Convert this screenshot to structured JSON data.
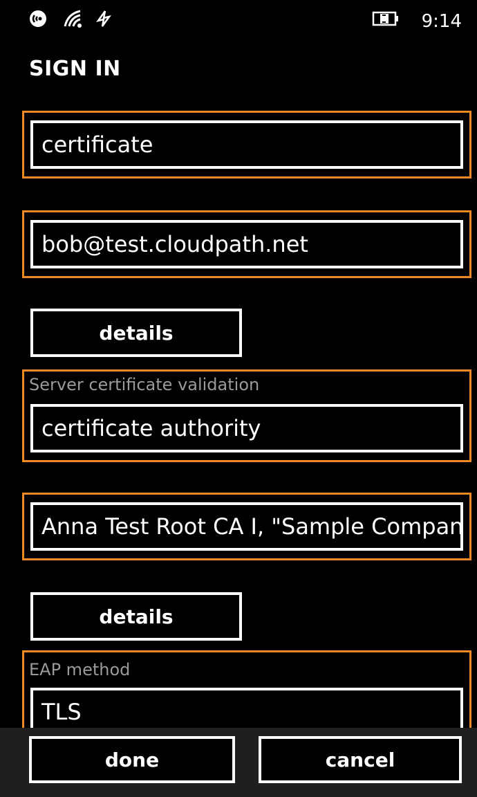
{
  "status_bar": {
    "icons": [
      "nfc-icon",
      "wifi-icon",
      "data-sync-icon",
      "battery-charging-icon"
    ],
    "time": "9:14"
  },
  "page": {
    "title": "SIGN IN"
  },
  "form": {
    "username_value": "certificate",
    "identity_value": "bob@test.cloudpath.net",
    "details_label_1": "details",
    "server_validation_label": "Server certificate validation",
    "server_validation_value": "certificate authority",
    "ca_value": "Anna Test Root CA I, \"Sample Company\"",
    "details_label_2": "details",
    "eap_method_label": "EAP method",
    "eap_method_value": "TLS"
  },
  "app_bar": {
    "done_label": "done",
    "cancel_label": "cancel"
  },
  "colors": {
    "highlight": "#f08a24",
    "background": "#000000",
    "foreground": "#ffffff",
    "label": "#9a9a9a",
    "app_bar": "#1f1f1f"
  }
}
